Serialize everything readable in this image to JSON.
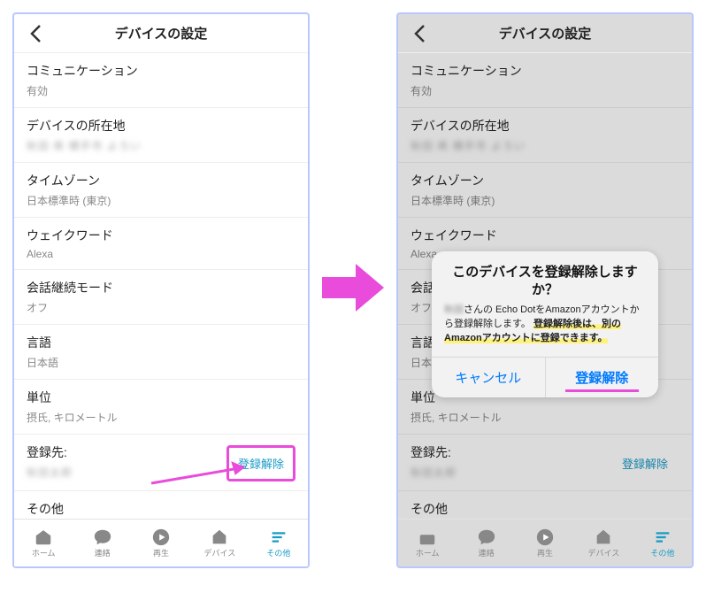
{
  "header": {
    "title": "デバイスの設定"
  },
  "rows": {
    "communication": {
      "label": "コミュニケーション",
      "value": "有効"
    },
    "location": {
      "label": "デバイスの所在地",
      "blurred": "秋田 県 横手市 よろい"
    },
    "timezone": {
      "label": "タイムゾーン",
      "value": "日本標準時 (東京)"
    },
    "wakeword": {
      "label": "ウェイクワード",
      "value": "Alexa"
    },
    "followup": {
      "label": "会話継続モード",
      "value": "オフ"
    },
    "language": {
      "label": "言語",
      "value": "日本語"
    },
    "units": {
      "label": "単位",
      "value": "摂氏, キロメートル"
    },
    "register": {
      "label": "登録先:",
      "blurred": "秋田太郎",
      "button": "登録解除"
    },
    "other": {
      "label": "その他"
    }
  },
  "tabs": {
    "home": "ホーム",
    "chat": "連絡",
    "play": "再生",
    "device": "デバイス",
    "more": "その他"
  },
  "dialog": {
    "title": "このデバイスを登録解除しますか？",
    "body_blur": "秋田",
    "body_1": "さんの Echo DotをAmazonアカウントから登録解除します。",
    "body_hl": "登録解除後は、別のAmazonアカウントに登録できます。",
    "cancel": "キャンセル",
    "confirm": "登録解除"
  }
}
